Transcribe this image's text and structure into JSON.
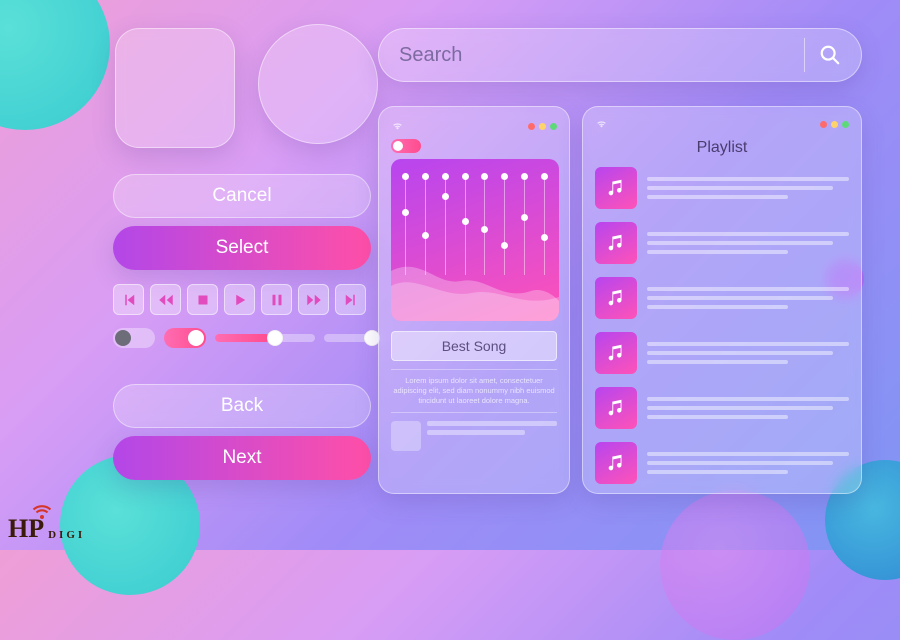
{
  "search": {
    "placeholder": "Search"
  },
  "buttons": {
    "cancel": "Cancel",
    "select": "Select",
    "back": "Back",
    "next": "Next"
  },
  "music": {
    "song_label": "Best Song",
    "description": "Lorem ipsum dolor sit amet, consectetuer adipiscing elit, sed diam nonummy nibh euismod tincidunt ut laoreet dolore magna."
  },
  "playlist": {
    "title": "Playlist",
    "count": 6
  },
  "logo": {
    "main": "HP",
    "sub": "DIGI"
  },
  "eq_points": [
    0.35,
    0.58,
    0.2,
    0.44,
    0.52,
    0.68,
    0.4,
    0.6
  ]
}
